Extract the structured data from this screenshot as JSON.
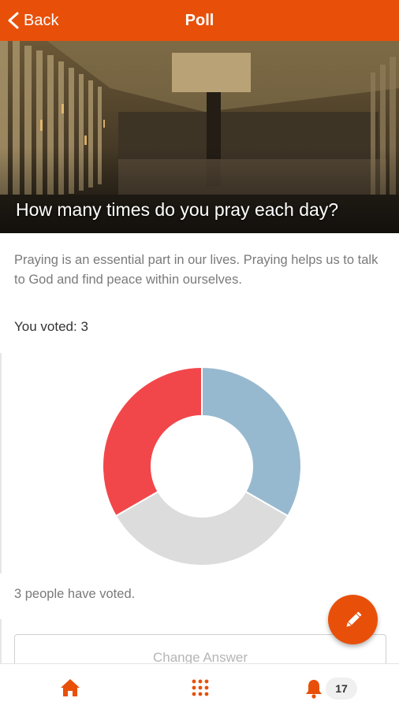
{
  "header": {
    "back_label": "Back",
    "title": "Poll",
    "accent_color": "#e8500a"
  },
  "poll": {
    "question": "How many times do you pray each day?",
    "description": "Praying is an essential part in our lives. Praying helps us to talk to God and find peace within ourselves.",
    "you_voted": "You voted: 3",
    "vote_count_text": "3 people have voted.",
    "change_answer_label": "Change Answer"
  },
  "chart_data": {
    "type": "pie",
    "style": "donut",
    "values": [
      1,
      1,
      1
    ],
    "colors": [
      "#97b9cf",
      "#dcdcdc",
      "#f2474a"
    ]
  },
  "fab": {
    "icon": "pencil-icon"
  },
  "bottom_nav": {
    "items": [
      {
        "icon": "home-icon"
      },
      {
        "icon": "grid-icon"
      },
      {
        "icon": "bell-icon"
      }
    ],
    "notification_count": "17"
  }
}
